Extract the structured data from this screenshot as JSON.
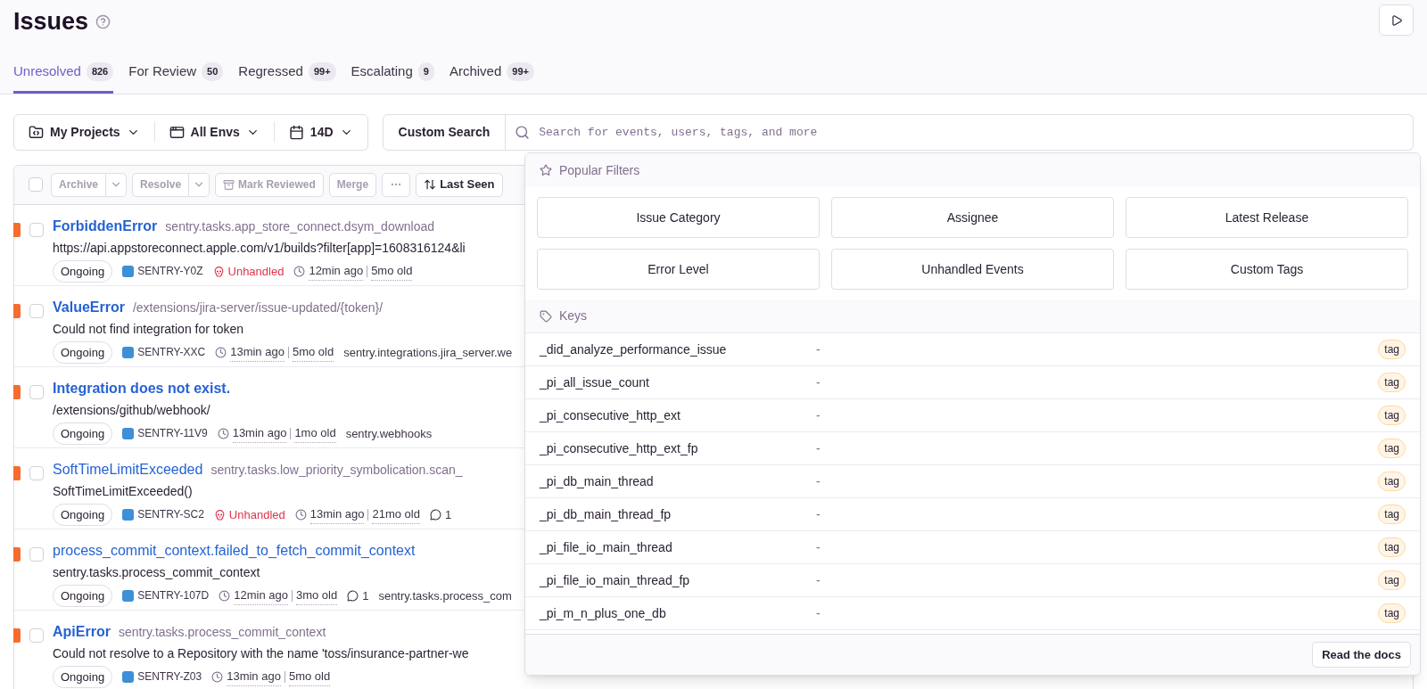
{
  "page": {
    "title": "Issues"
  },
  "tabs": [
    {
      "label": "Unresolved",
      "count": "826",
      "selected": true
    },
    {
      "label": "For Review",
      "count": "50",
      "selected": false
    },
    {
      "label": "Regressed",
      "count": "99+",
      "selected": false
    },
    {
      "label": "Escalating",
      "count": "9",
      "selected": false
    },
    {
      "label": "Archived",
      "count": "99+",
      "selected": false
    }
  ],
  "filters": [
    {
      "label": "My Projects"
    },
    {
      "label": "All Envs"
    },
    {
      "label": "14D"
    }
  ],
  "search": {
    "button": "Custom Search",
    "placeholder": "Search for events, users, tags, and more"
  },
  "toolbar": {
    "select_all": {
      "checked": false
    },
    "actions": [
      {
        "kind": "split",
        "label": "Archive",
        "disabled": true
      },
      {
        "kind": "split",
        "label": "Resolve",
        "disabled": true
      },
      {
        "kind": "review",
        "label": "Mark Reviewed",
        "disabled": true
      },
      {
        "kind": "plain",
        "label": "Merge",
        "disabled": true
      },
      {
        "kind": "more",
        "disabled": true
      },
      {
        "kind": "sort",
        "label": "Last Seen",
        "disabled": false
      }
    ]
  },
  "issues": [
    {
      "title": "ForbiddenError",
      "culprit": "sentry.tasks.app_store_connect.dsym_download",
      "message": "https://api.appstoreconnect.apple.com/v1/builds?filter[app]=1608316124&li",
      "seen": false,
      "checked": false,
      "meta": [
        {
          "kind": "status",
          "text": "Ongoing"
        },
        {
          "kind": "id",
          "text": "SENTRY-Y0Z"
        },
        {
          "kind": "unhandled",
          "text": "Unhandled"
        },
        {
          "kind": "time",
          "text": "12min ago",
          "age": "5mo old"
        }
      ]
    },
    {
      "title": "ValueError",
      "culprit": "/extensions/jira-server/issue-updated/{token}/",
      "message": "Could not find integration for token",
      "seen": false,
      "checked": false,
      "meta": [
        {
          "kind": "status",
          "text": "Ongoing"
        },
        {
          "kind": "id",
          "text": "SENTRY-XXC"
        },
        {
          "kind": "time",
          "text": "13min ago",
          "age": "5mo old"
        },
        {
          "kind": "text",
          "text": "sentry.integrations.jira_server.we"
        }
      ]
    },
    {
      "title": "Integration does not exist.",
      "message": "/extensions/github/webhook/",
      "seen": false,
      "checked": false,
      "meta": [
        {
          "kind": "status",
          "text": "Ongoing"
        },
        {
          "kind": "id",
          "text": "SENTRY-11V9"
        },
        {
          "kind": "time",
          "text": "13min ago",
          "age": "1mo old"
        },
        {
          "kind": "text",
          "text": "sentry.webhooks"
        }
      ]
    },
    {
      "title": "SoftTimeLimitExceeded",
      "culprit": "sentry.tasks.low_priority_symbolication.scan_",
      "message": "SoftTimeLimitExceeded()",
      "seen": true,
      "checked": false,
      "meta": [
        {
          "kind": "status",
          "text": "Ongoing"
        },
        {
          "kind": "id",
          "text": "SENTRY-SC2"
        },
        {
          "kind": "unhandled",
          "text": "Unhandled"
        },
        {
          "kind": "time",
          "text": "13min ago",
          "age": "21mo old"
        },
        {
          "kind": "comments",
          "text": "1"
        }
      ]
    },
    {
      "title": "process_commit_context.failed_to_fetch_commit_context",
      "message": "sentry.tasks.process_commit_context",
      "seen": true,
      "checked": false,
      "meta": [
        {
          "kind": "status",
          "text": "Ongoing"
        },
        {
          "kind": "id",
          "text": "SENTRY-107D"
        },
        {
          "kind": "time",
          "text": "12min ago",
          "age": "3mo old"
        },
        {
          "kind": "comments",
          "text": "1"
        },
        {
          "kind": "text",
          "text": "sentry.tasks.process_com"
        }
      ]
    },
    {
      "title": "ApiError",
      "culprit": "sentry.tasks.process_commit_context",
      "message": "Could not resolve to a Repository with the name 'toss/insurance-partner-we",
      "seen": false,
      "checked": false,
      "meta": [
        {
          "kind": "status",
          "text": "Ongoing"
        },
        {
          "kind": "id",
          "text": "SENTRY-Z03"
        },
        {
          "kind": "time",
          "text": "13min ago",
          "age": "5mo old"
        }
      ]
    }
  ],
  "dropdown": {
    "popular_heading": "Popular Filters",
    "popular": [
      "Issue Category",
      "Assignee",
      "Latest Release",
      "Error Level",
      "Unhandled Events",
      "Custom Tags"
    ],
    "keys_heading": "Keys",
    "keys": [
      {
        "name": "_did_analyze_performance_issue",
        "value": "-",
        "badge": "tag"
      },
      {
        "name": "_pi_all_issue_count",
        "value": "-",
        "badge": "tag"
      },
      {
        "name": "_pi_consecutive_http_ext",
        "value": "-",
        "badge": "tag"
      },
      {
        "name": "_pi_consecutive_http_ext_fp",
        "value": "-",
        "badge": "tag"
      },
      {
        "name": "_pi_db_main_thread",
        "value": "-",
        "badge": "tag"
      },
      {
        "name": "_pi_db_main_thread_fp",
        "value": "-",
        "badge": "tag"
      },
      {
        "name": "_pi_file_io_main_thread",
        "value": "-",
        "badge": "tag"
      },
      {
        "name": "_pi_file_io_main_thread_fp",
        "value": "-",
        "badge": "tag"
      },
      {
        "name": "_pi_m_n_plus_one_db",
        "value": "-",
        "badge": "tag"
      }
    ],
    "docs_button": "Read the docs"
  }
}
